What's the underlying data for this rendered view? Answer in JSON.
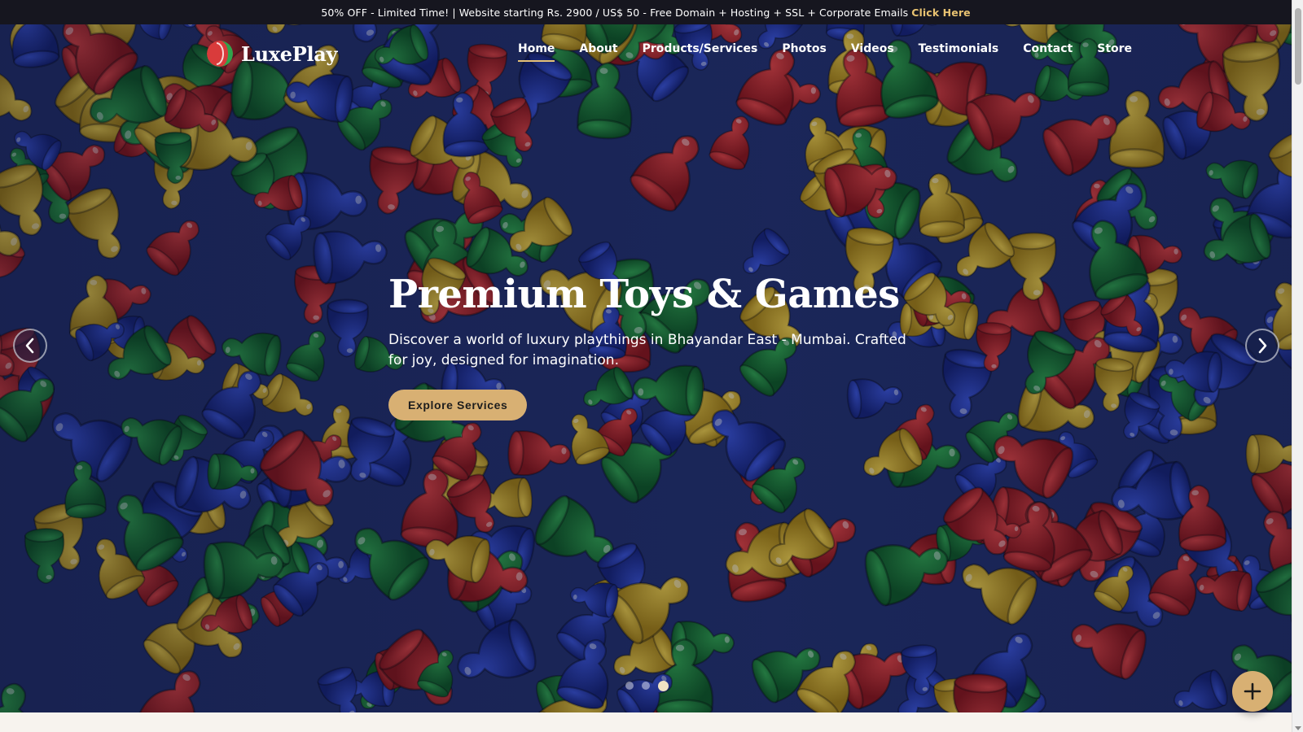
{
  "announcement": {
    "text": "50% OFF - Limited Time! | Website starting Rs. 2900 / US$ 50 - Free Domain + Hosting + SSL + Corporate Emails",
    "cta": "Click Here"
  },
  "brand": {
    "name": "LuxePlay",
    "colors": {
      "accent": "#d8b073",
      "dark": "#16161f",
      "underline": "#e6c177"
    }
  },
  "nav": {
    "items": [
      {
        "label": "Home",
        "active": true
      },
      {
        "label": "About"
      },
      {
        "label": "Products/Services"
      },
      {
        "label": "Photos"
      },
      {
        "label": "Videos"
      },
      {
        "label": "Testimonials"
      },
      {
        "label": "Contact"
      },
      {
        "label": "Store"
      }
    ]
  },
  "hero": {
    "title": "Premium Toys & Games",
    "subtitle": "Discover a world of luxury playthings in Bhayandar East - Mumbai. Crafted for joy, designed for imagination.",
    "button": "Explore Services",
    "background_icon": "colorful-game-pawns-image",
    "slides": 3,
    "active_slide": 3
  },
  "controls": {
    "prev_icon": "chevron-left-icon",
    "next_icon": "chevron-right-icon",
    "fab_icon": "plus-icon"
  }
}
